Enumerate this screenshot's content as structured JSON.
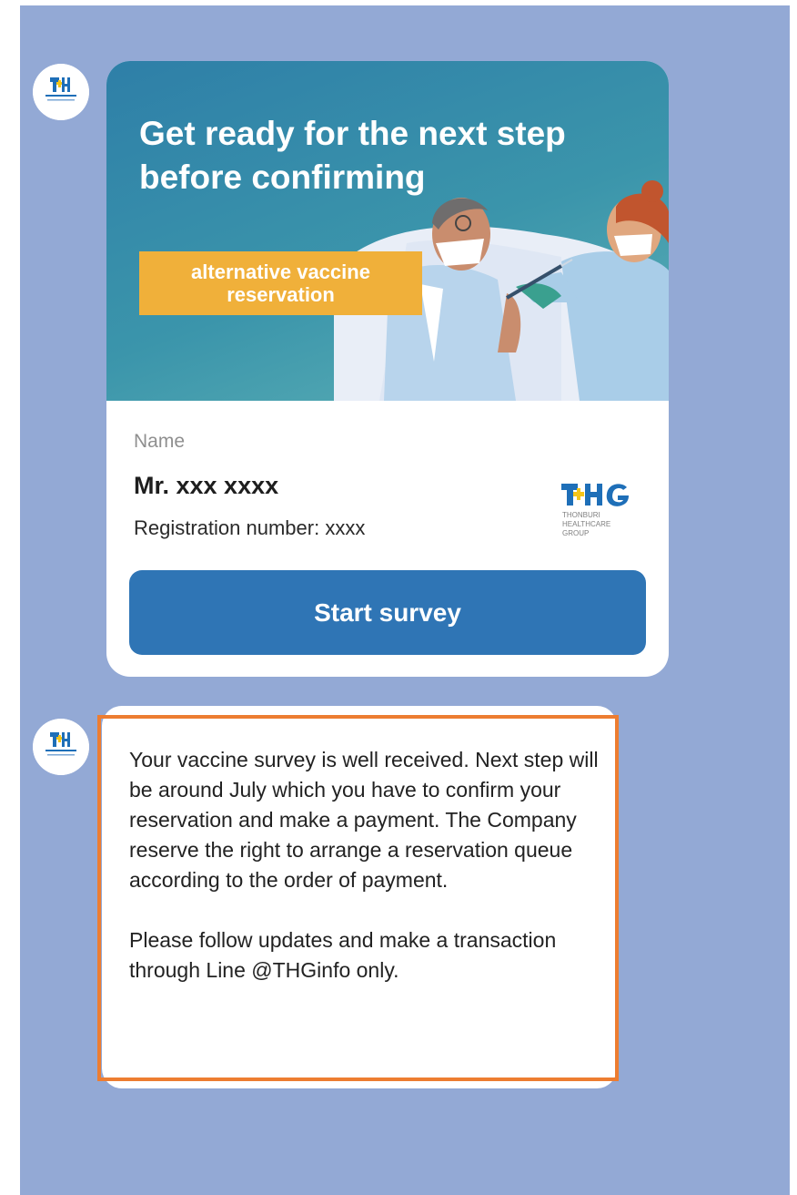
{
  "card": {
    "hero_title": "Get ready for the next step before confirming",
    "hero_badge": "alternative vaccine reservation",
    "name_label": "Name",
    "name_value": "Mr. xxx xxxx",
    "registration": "Registration number: xxxx",
    "start_button": "Start survey",
    "logo": {
      "mark": "THG",
      "line1": "THONBURI",
      "line2": "HEALTHCARE",
      "line3": "GROUP"
    }
  },
  "message": {
    "paragraph1": "Your vaccine survey is well received. Next step will be around July which you have to confirm your reservation and make a payment. The Company reserve the right to arrange a reservation queue according to the order of payment.",
    "paragraph2": "Please follow updates and make a transaction through Line @THGinfo only."
  },
  "colors": {
    "chat_background": "#93a9d5",
    "button": "#2f75b5",
    "badge": "#f0b03a",
    "highlight_border": "#ed7d31",
    "logo_blue": "#1e6fb8",
    "logo_yellow": "#f5c518"
  },
  "icons": {
    "avatar": "thg-logo-icon"
  }
}
